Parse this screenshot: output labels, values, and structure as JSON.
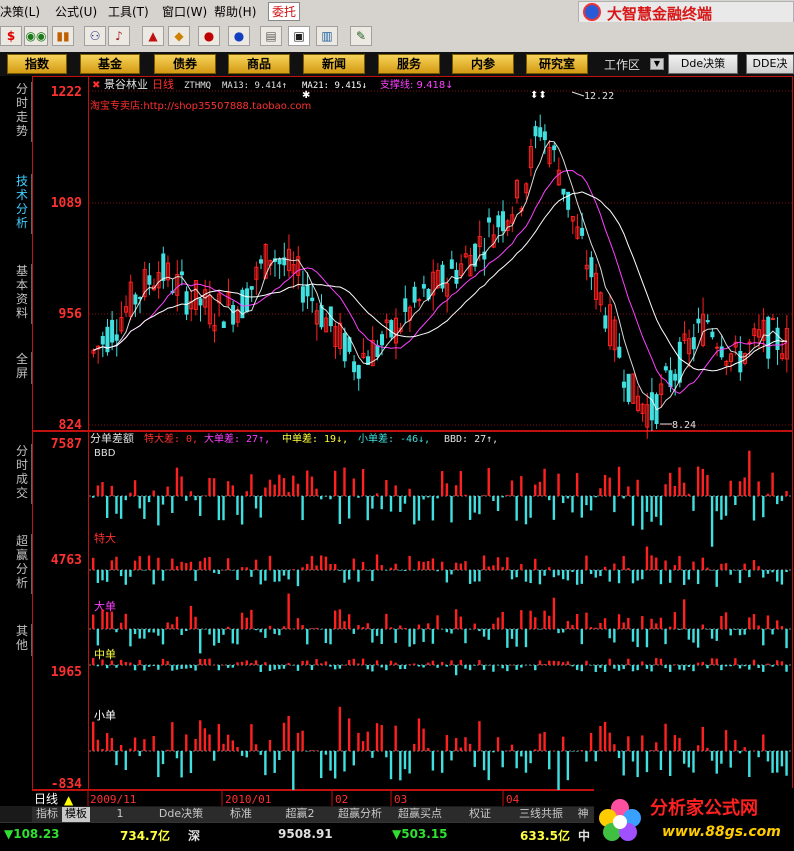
{
  "menu": {
    "items": [
      "决策(L)",
      "公式(U)",
      "工具(T)",
      "窗口(W)",
      "帮助(H)"
    ],
    "special": "委托",
    "brand": "大智慧金融终端"
  },
  "nav": {
    "buttons": [
      "指数",
      "基金",
      "债券",
      "商品",
      "新闻",
      "服务",
      "内参",
      "研究室"
    ],
    "workspace": "工作区",
    "dde1": "Dde决策",
    "dde2": "DDE决"
  },
  "sidebar": {
    "tabs": [
      "分时走势",
      "技术分析",
      "基本资料",
      "全屏",
      "分时成交",
      "超赢分析",
      "其他"
    ]
  },
  "chart": {
    "stock_name": "景谷林业",
    "period": "日线",
    "ma_label": "ZTHMQ",
    "ma13": "MA13: 9.414↑",
    "ma21": "MA21: 9.415↓",
    "support": "支撑线: 9.418↓",
    "shop": "淘宝专卖店:http://shop35507888.taobao.com",
    "high_mark": "12.22",
    "low_mark": "8.24",
    "price_ticks": [
      "1222",
      "1089",
      "956",
      "824"
    ],
    "sub_title": "分单差额",
    "sub_vals": {
      "tedacha": "特大差: 0,",
      "dadancha": "大单差: 27↑,",
      "zhongdancha": "中单差: 19↓,",
      "xiaodancha": "小单差: -46↓,",
      "bbd": "BBD: 27↑,"
    },
    "sub_ticks": [
      "7587",
      "4763",
      "1965",
      "-834"
    ],
    "band_labels": [
      "BBD",
      "特大",
      "大单",
      "中单",
      "小单"
    ],
    "date_labels": [
      "2009/11",
      "2010/01",
      "02",
      "03",
      "04"
    ],
    "period_corner": "日线"
  },
  "chart_data": {
    "type": "candlestick",
    "ylim": [
      8.24,
      12.22
    ],
    "high": 12.22,
    "low": 8.24,
    "indicators": {
      "ma13": 9.414,
      "ma21": 9.415,
      "support": 9.418
    },
    "sub_indicators": {
      "特大差": 0,
      "大单差": 27,
      "中单差": 19,
      "小单差": -46,
      "BBD": 27
    }
  },
  "tabs": [
    "指标",
    "模板",
    "1",
    "Dde决策",
    "标准",
    "超赢2",
    "超赢分析",
    "超赢买点",
    "权证",
    "三线共振",
    "神"
  ],
  "status": {
    "idx1": "▼108.23",
    "amt1": "734.7亿",
    "mkt": "深",
    "idx2": "9508.91",
    "idx3": "▼503.15",
    "amt2": "633.5亿",
    "mkt2": "中"
  },
  "watermark": {
    "title": "分析家公式网",
    "url": "www.88gs.com"
  },
  "colors": {
    "up": "#ff2020",
    "down": "#40e0e0",
    "ma13": "#ff40ff",
    "ma21": "#ffffff",
    "axis": "#ff2020"
  }
}
